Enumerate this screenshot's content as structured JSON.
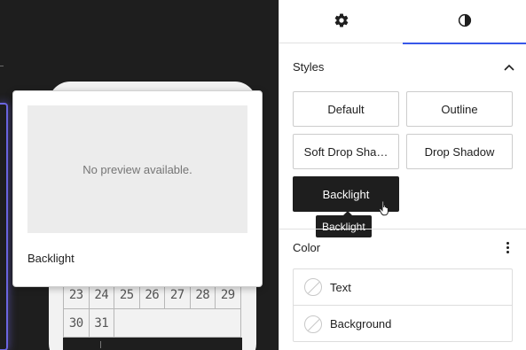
{
  "preview": {
    "placeholder": "No preview available.",
    "style_name": "Backlight"
  },
  "calendar": {
    "rows": [
      [
        "23",
        "24",
        "25",
        "26",
        "27",
        "28",
        "29"
      ],
      [
        "30",
        "31",
        "",
        "",
        "",
        "",
        ""
      ]
    ]
  },
  "sidebar": {
    "tabs": [
      {
        "icon": "gear-icon"
      },
      {
        "icon": "contrast-icon",
        "active": true
      }
    ],
    "styles": {
      "heading": "Styles",
      "options": [
        "Default",
        "Outline",
        "Soft Drop Sha…",
        "Drop Shadow",
        "Backlight"
      ],
      "active": "Backlight",
      "tooltip": "Backlight"
    },
    "color": {
      "heading": "Color",
      "items": [
        "Text",
        "Background"
      ]
    }
  },
  "colors": {
    "canvas_bg": "#1e1e1e",
    "accent": "#3858e9",
    "active_button": "#1e1e1e",
    "selection_outline": "#6b66e0"
  }
}
